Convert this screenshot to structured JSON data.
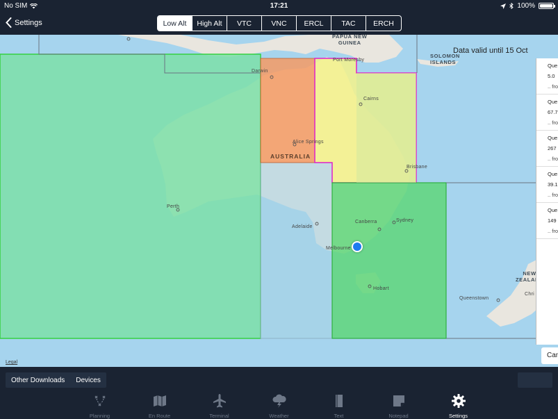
{
  "status_bar": {
    "carrier": "No SIM",
    "time": "17:21",
    "battery": "100%",
    "battery_level": 1.0
  },
  "nav": {
    "back_label": "Settings",
    "chart_types": [
      {
        "label": "Low Alt",
        "active": true
      },
      {
        "label": "High Alt",
        "active": false
      },
      {
        "label": "VTC",
        "active": false
      },
      {
        "label": "VNC",
        "active": false
      },
      {
        "label": "ERCL",
        "active": false
      },
      {
        "label": "TAC",
        "active": false
      },
      {
        "label": "ERCH",
        "active": false
      }
    ]
  },
  "map": {
    "data_valid": "Data valid until 15 Oct",
    "legal": "Legal",
    "labels": {
      "png": "PAPUA NEW\nGUINEA",
      "solomon": "SOLOMON\nISLANDS",
      "australia": "AUSTRALIA",
      "new_zealand": "NEW\nZEALAND",
      "port_moresby": "Port Moresby",
      "darwin": "Darwin",
      "cairns": "Cairns",
      "alice_springs": "Alice Springs",
      "brisbane": "Brisbane",
      "perth": "Perth",
      "adelaide": "Adelaide",
      "canberra": "Canberra",
      "sydney": "Sydney",
      "melbourne": "Melbourne",
      "hobart": "Hobart",
      "queenstown": "Queenstown",
      "christchurch": "Chri"
    },
    "colors": {
      "ocean": "#a6d4ee",
      "land": "#e9e6df",
      "region_west": "#7ddfa8",
      "region_nt": "#f59a64",
      "region_qld": "#f5f28a",
      "region_nsw": "#5fd67a",
      "region_sa": "#a6d1e4",
      "region_qld_border": "#e020c8",
      "region_west_border": "#35d040"
    }
  },
  "queue": {
    "items": [
      {
        "title": "Que",
        "value": "5.0",
        "sub": ".. fro"
      },
      {
        "title": "Que",
        "value": "67.7",
        "sub": ".. fro"
      },
      {
        "title": "Que",
        "value": "267",
        "sub": ".. fro"
      },
      {
        "title": "Que",
        "value": "39.1",
        "sub": ".. fro"
      },
      {
        "title": "Que",
        "value": "149",
        "sub": ".. fro"
      }
    ],
    "cancel_label": "Can"
  },
  "downloads": {
    "other_downloads": "Other Downloads",
    "devices": "Devices"
  },
  "tabs": [
    {
      "label": "Planning",
      "icon": "planning-icon",
      "active": false
    },
    {
      "label": "En Route",
      "icon": "map-icon",
      "active": false
    },
    {
      "label": "Terminal",
      "icon": "plane-icon",
      "active": false
    },
    {
      "label": "Weather",
      "icon": "weather-icon",
      "active": false
    },
    {
      "label": "Text",
      "icon": "book-icon",
      "active": false
    },
    {
      "label": "Notepad",
      "icon": "notepad-icon",
      "active": false
    },
    {
      "label": "Settings",
      "icon": "gear-icon",
      "active": true
    }
  ]
}
